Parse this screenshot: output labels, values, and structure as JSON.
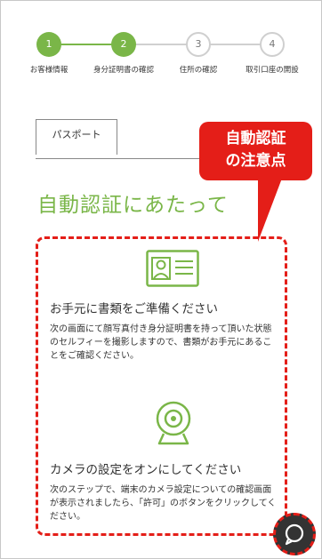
{
  "stepper": {
    "steps": [
      {
        "number": "1",
        "label": "お客様情報",
        "state": "done"
      },
      {
        "number": "2",
        "label": "身分証明書の確認",
        "state": "done"
      },
      {
        "number": "3",
        "label": "住所の確認",
        "state": "todo"
      },
      {
        "number": "4",
        "label": "取引口座の開設",
        "state": "todo"
      }
    ]
  },
  "tab": {
    "label": "パスポート"
  },
  "heading": "自動認証にあたって",
  "callout": {
    "line1": "自動認証",
    "line2": "の注意点"
  },
  "items": [
    {
      "icon": "id-card-icon",
      "title": "お手元に書類をご準備ください",
      "description": "次の画面にて顔写真付き身分証明書を持って頂いた状態のセルフィーを撮影しますので、書類がお手元にあることをご確認ください。"
    },
    {
      "icon": "webcam-icon",
      "title": "カメラの設定をオンにしてください",
      "description": "次のステップで、端末のカメラ設定についての確認画面が表示されましたら、「許可」のボタンをクリックしてください。"
    }
  ],
  "colors": {
    "accent": "#7ab648",
    "highlight": "#e41e18",
    "chat": "#333333"
  },
  "chat_button": {
    "icon": "chat-bubble-icon"
  }
}
